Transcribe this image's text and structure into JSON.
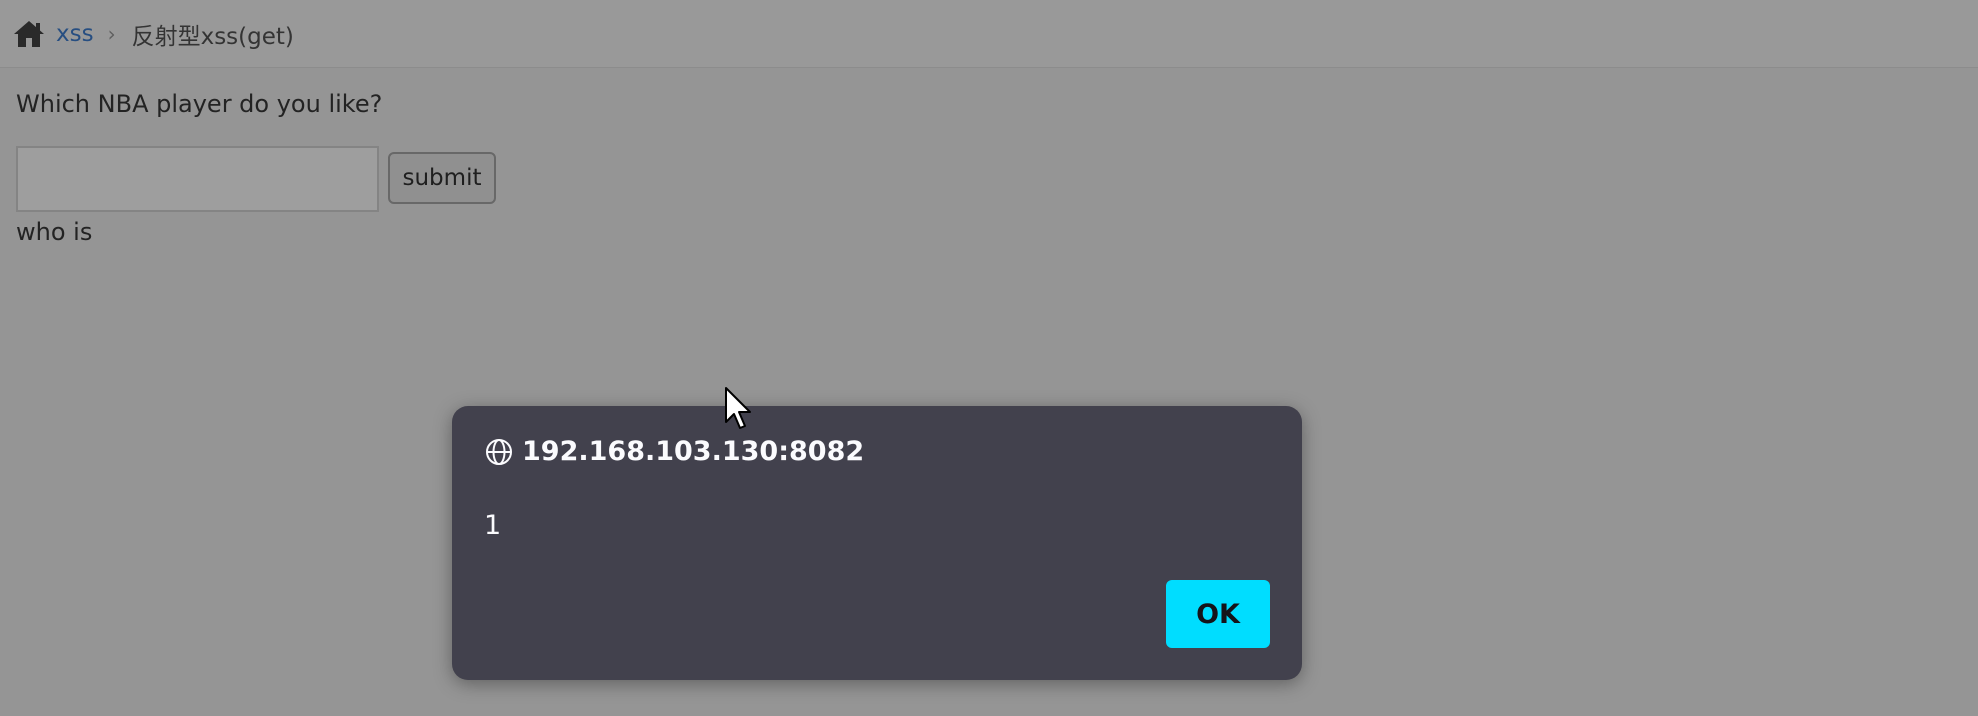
{
  "breadcrumb": {
    "home_icon": "home-icon",
    "link_label": "xss",
    "separator": "›",
    "current_label": "反射型xss(get)"
  },
  "form": {
    "question": "Which NBA player do you like?",
    "input_value": "",
    "input_placeholder": "",
    "submit_label": "submit",
    "result_text": "who is"
  },
  "dialog": {
    "icon": "globe-icon",
    "title": "192.168.103.130:8082",
    "message": "1",
    "ok_label": "OK"
  },
  "colors": {
    "dialog_bg": "#42414d",
    "ok_button": "#00ddff",
    "link": "#3f7fd0"
  }
}
